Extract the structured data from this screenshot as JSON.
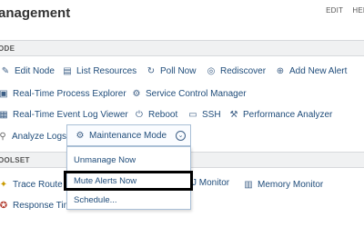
{
  "header": {
    "title": "anagement",
    "links": [
      "EDIT",
      "HELI"
    ]
  },
  "sections": {
    "node": "ODE",
    "toolset": "OOLSET"
  },
  "node_actions": {
    "edit_node": "Edit Node",
    "list_resources": "List Resources",
    "poll_now": "Poll Now",
    "rediscover": "Rediscover",
    "add_new_alert": "Add New Alert",
    "realtime_process_explorer": "Real-Time Process Explorer",
    "service_control_manager": "Service Control Manager",
    "realtime_event_log_viewer": "Real-Time Event Log Viewer",
    "reboot": "Reboot",
    "ssh": "SSH",
    "performance_analyzer": "Performance Analyzer",
    "analyze_logs": "Analyze Logs"
  },
  "maintenance": {
    "button_label": "Maintenance Mode",
    "menu": [
      "Unmanage Now",
      "Mute Alerts Now",
      "Schedule..."
    ]
  },
  "toolset": {
    "trace_route": "Trace Route",
    "response_time": "Response Tim",
    "cpu_monitor_fragment": "J Monitor",
    "memory_monitor": "Memory Monitor"
  }
}
